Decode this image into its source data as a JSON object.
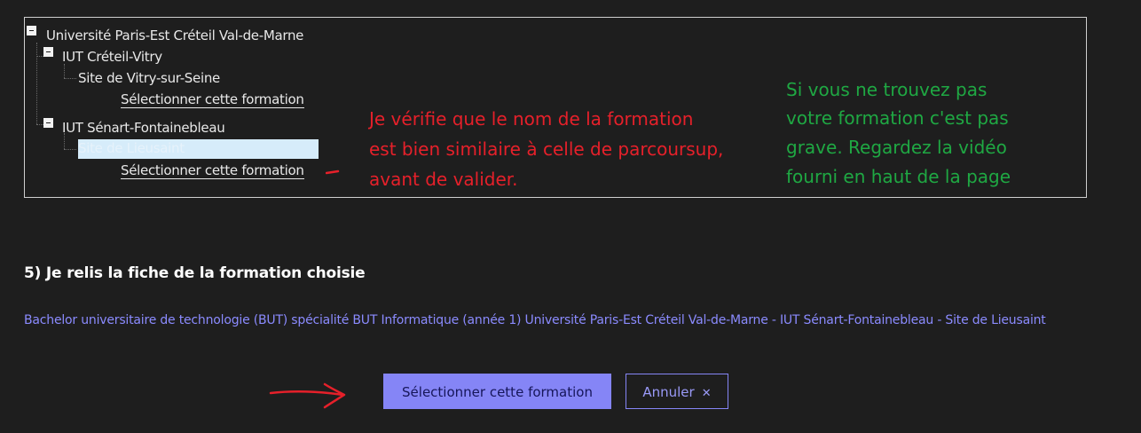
{
  "tree": {
    "root": {
      "label": "Université Paris-Est Créteil Val-de-Marne"
    },
    "nodes": [
      {
        "label": "IUT Créteil-Vitry",
        "site": "Site de Vitry-sur-Seine",
        "select_label": "Sélectionner cette formation"
      },
      {
        "label": "IUT Sénart-Fontainebleau",
        "site": "Site de Lieusaint",
        "select_label": "Sélectionner cette formation"
      }
    ]
  },
  "annotations": {
    "red_note": [
      "Je vérifie que le nom de la formation",
      "est bien similaire à celle de parcoursup,",
      "avant de valider."
    ],
    "green_note": [
      "Si vous ne trouvez pas",
      "votre formation c'est pas",
      "grave. Regardez la vidéo",
      "fourni en haut de la page"
    ],
    "red_color": "#e6202a",
    "green_color": "#1fa843"
  },
  "section": {
    "title": "5) Je relis la fiche de la formation choisie",
    "fiche": "Bachelor universitaire de technologie (BUT) spécialité BUT Informatique (année 1) Université Paris-Est Créteil Val-de-Marne - IUT Sénart-Fontainebleau - Site de Lieusaint"
  },
  "actions": {
    "confirm_label": "Sélectionner cette formation",
    "cancel_label": "Annuler",
    "cancel_icon": "close-icon",
    "accent_color": "#8585f6"
  }
}
